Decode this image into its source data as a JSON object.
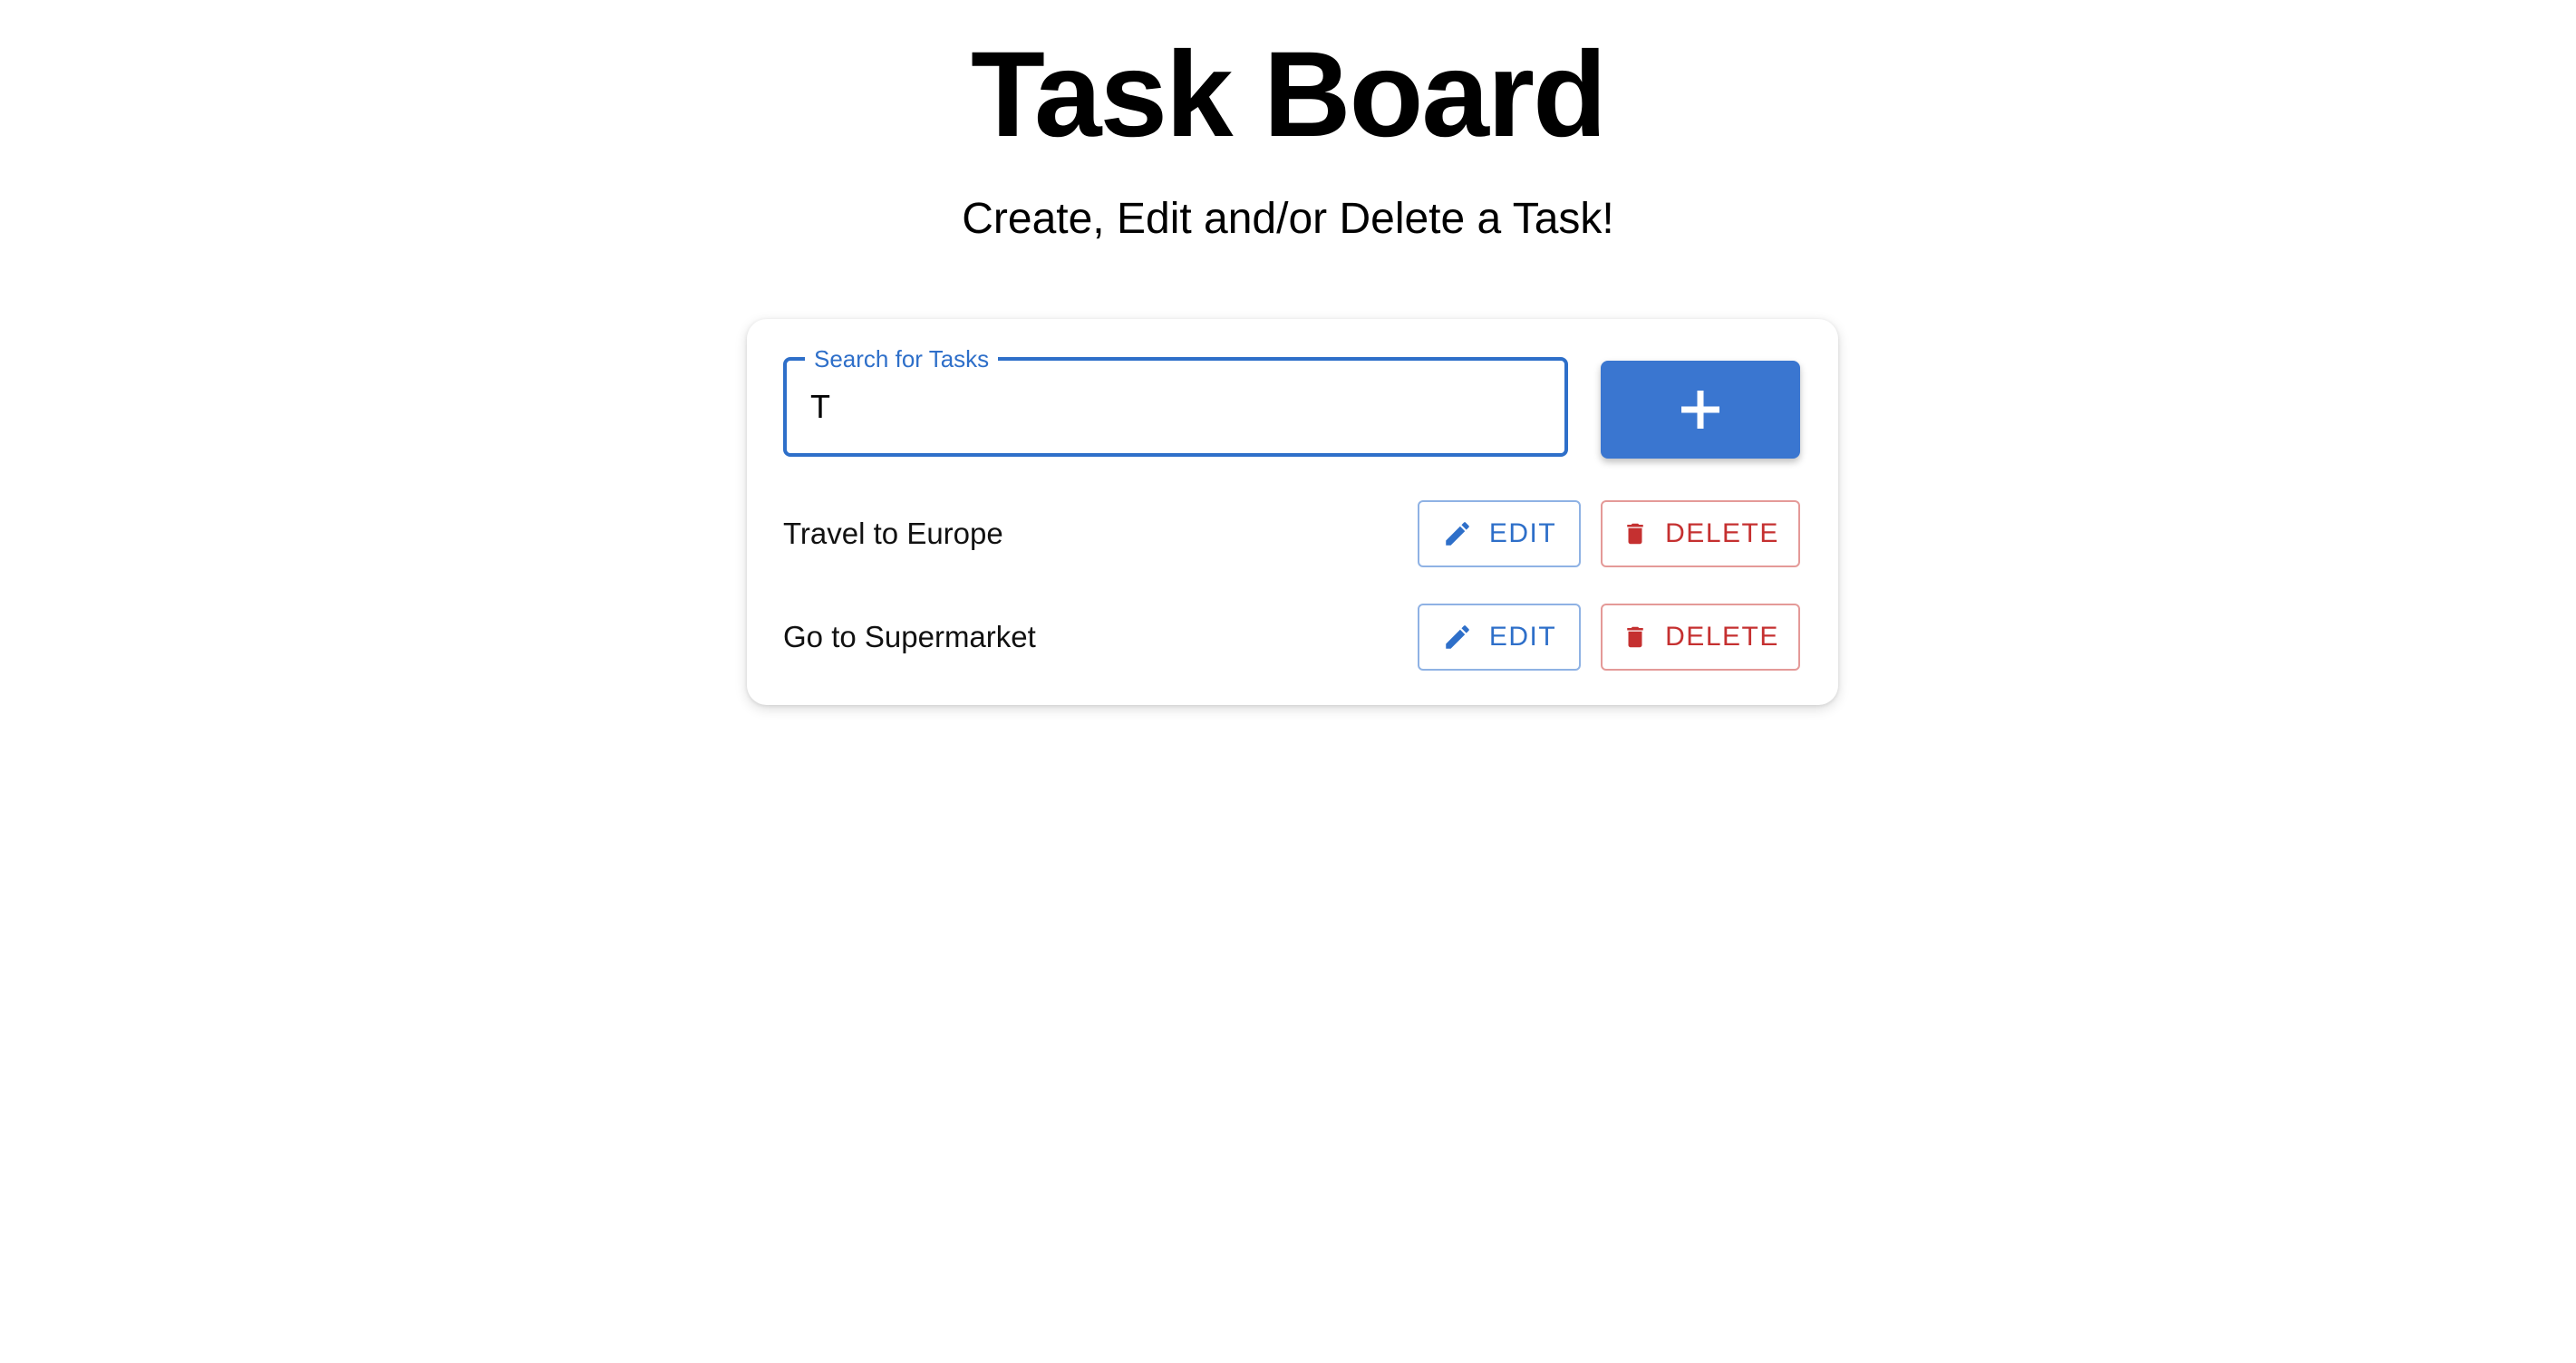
{
  "header": {
    "title": "Task Board",
    "subtitle": "Create, Edit and/or Delete a Task!"
  },
  "search": {
    "label": "Search for Tasks",
    "value": "T"
  },
  "add_button": {
    "icon": "plus-icon"
  },
  "tasks": [
    {
      "label": "Travel to Europe",
      "edit_label": "EDIT",
      "delete_label": "DELETE"
    },
    {
      "label": "Go to Supermarket",
      "edit_label": "EDIT",
      "delete_label": "DELETE"
    }
  ],
  "colors": {
    "primary": "#3a76d0",
    "danger": "#c53030",
    "outline_focus": "#2e6fc9"
  }
}
